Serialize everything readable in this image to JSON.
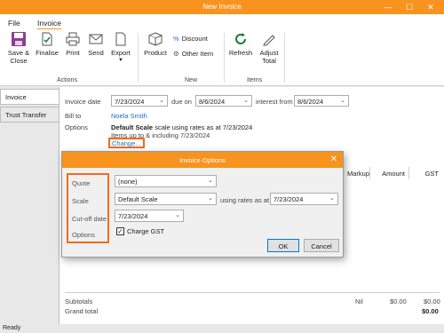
{
  "window": {
    "title": "New Invoice",
    "controls": {
      "minimize": "—",
      "maximize": "☐",
      "close": "✕"
    }
  },
  "menu": {
    "items": [
      "File",
      "Invoice"
    ]
  },
  "ribbon": {
    "actions": {
      "save_close": "Save &\nClose",
      "finalise": "Finalise",
      "print": "Print",
      "send": "Send",
      "export": "Export",
      "group_label": "Actions"
    },
    "new": {
      "product": "Product",
      "discount": "Discount",
      "other_item": "Other Item",
      "group_label": "New"
    },
    "items": {
      "refresh": "Refresh",
      "adjust_total": "Adjust\nTotal",
      "group_label": "Items"
    }
  },
  "sidebar": {
    "tabs": [
      "Invoice",
      "Trust Transfer"
    ]
  },
  "form": {
    "invoice_date_label": "Invoice date",
    "invoice_date": "7/23/2024",
    "due_on_label": "due on",
    "due_on": "8/6/2024",
    "interest_from_label": "interest from",
    "interest_from": "8/6/2024",
    "bill_to_label": "Bill to",
    "bill_to": "Noela Smith",
    "options_label": "Options",
    "options_scale_bold": "Default Scale",
    "options_scale_rest": " scale using rates as at 7/23/2024",
    "options_items": "Items up to & including 7/23/2024",
    "change_link": "Change..."
  },
  "table": {
    "headers": [
      "Markup",
      "Amount",
      "GST"
    ]
  },
  "totals": {
    "subtotals_label": "Subtotals",
    "subtotal_nil": "Nil",
    "subtotal_amount": "$0.00",
    "subtotal_gst": "$0.00",
    "grand_total_label": "Grand total",
    "grand_total": "$0.00"
  },
  "status": {
    "text": "Ready"
  },
  "dialog": {
    "title": "Invoice Options",
    "close": "✕",
    "labels": {
      "quote": "Quote",
      "scale": "Scale",
      "cutoff": "Cut-off date",
      "options": "Options"
    },
    "quote_value": "(none)",
    "scale_value": "Default Scale",
    "rates_label": "using rates as at",
    "rates_date": "7/23/2024",
    "cutoff_date": "7/23/2024",
    "charge_gst_label": "Charge GST",
    "charge_gst_checked": true,
    "ok_label": "OK",
    "cancel_label": "Cancel"
  },
  "colors": {
    "accent": "#f7931e",
    "highlight": "#f26b1d",
    "link": "#1a6fc4"
  }
}
